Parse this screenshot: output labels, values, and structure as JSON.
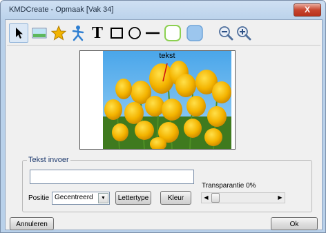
{
  "window": {
    "title": "KMDCreate - Opmaak [Vak 34]",
    "close_glyph": "X"
  },
  "toolbar": {
    "tools": [
      {
        "name": "pointer-icon",
        "active": true
      },
      {
        "name": "image-icon",
        "active": false
      },
      {
        "name": "star-icon",
        "active": false
      },
      {
        "name": "figure-icon",
        "active": false
      },
      {
        "name": "text-icon",
        "active": false,
        "glyph": "T"
      },
      {
        "name": "rectangle-icon",
        "active": false
      },
      {
        "name": "circle-icon",
        "active": false
      },
      {
        "name": "line-icon",
        "active": false
      },
      {
        "name": "rounded-rect-outline-icon",
        "active": false
      },
      {
        "name": "rounded-rect-filled-icon",
        "active": false
      },
      {
        "name": "zoom-out-icon",
        "active": false
      },
      {
        "name": "zoom-in-icon",
        "active": false
      }
    ]
  },
  "preview": {
    "label": "tekst"
  },
  "text_input": {
    "legend": "Tekst invoer",
    "value": "",
    "position_label": "Positie",
    "position_value": "Gecentreerd",
    "font_button": "Lettertype",
    "color_button": "Kleur",
    "transparency_label": "Transparantie 0%",
    "transparency": 0
  },
  "footer": {
    "cancel": "Annuleren",
    "ok": "Ok"
  }
}
